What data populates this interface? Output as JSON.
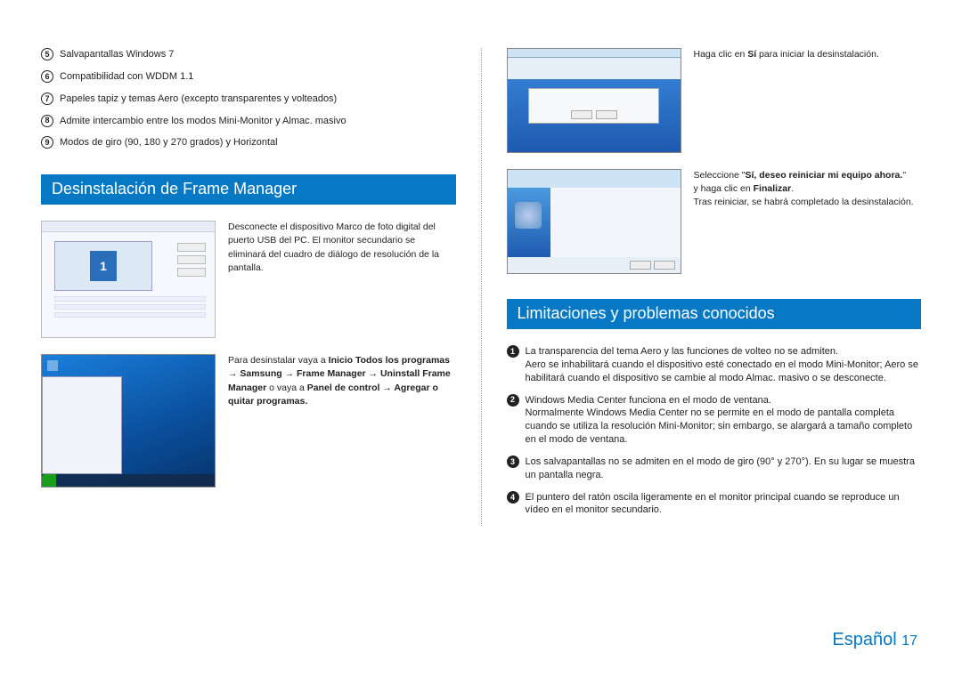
{
  "left": {
    "features": [
      {
        "n": "5",
        "text": "Salvapantallas Windows 7"
      },
      {
        "n": "6",
        "text": "Compatibilidad con WDDM 1.1"
      },
      {
        "n": "7",
        "text": "Papeles tapiz y temas Aero (excepto transparentes y volteados)"
      },
      {
        "n": "8",
        "text": "Admite intercambio entre los modos Mini-Monitor y Almac. masivo"
      },
      {
        "n": "9",
        "text": "Modos de giro (90, 180 y 270 grados) y Horizontal"
      }
    ],
    "uninstall_header": "Desinstalación de Frame Manager",
    "row1": "Desconecte el dispositivo Marco de foto digital del puerto USB del PC. El monitor secundario se eliminará del cuadro de diálogo de resolución de la pantalla.",
    "row2_pre": "Para desinstalar vaya a ",
    "row2_b1": "Inicio Todos los programas → Samsung → Frame Manager → Uninstall Frame Manager",
    "row2_mid": " o vaya a ",
    "row2_b2": "Panel de control → Agregar o quitar programas.",
    "mon_number": "1"
  },
  "right": {
    "row1_pre": "Haga clic en ",
    "row1_b": "Sí",
    "row1_post": " para iniciar la desinstalación.",
    "row2_l1_pre": "Seleccione \"",
    "row2_l1_b": "Sí, deseo reiniciar mi equipo ahora.",
    "row2_l1_post": "\"",
    "row2_l2_pre": "y haga clic en ",
    "row2_l2_b": "Finalizar",
    "row2_l2_post": ".",
    "row2_l3": "Tras reiniciar, se habrá completado la desinstalación.",
    "limits_header": "Limitaciones y problemas conocidos",
    "limits": [
      {
        "n": "1",
        "t1": "La transparencia del tema Aero y las funciones de volteo no se admiten.",
        "t2": "Aero se inhabilitará cuando el dispositivo esté conectado en el modo Mini-Monitor; Aero se habilitará cuando el dispositivo se cambie al modo Almac. masivo o se desconecte."
      },
      {
        "n": "2",
        "t1": "Windows Media Center funciona en el modo de ventana.",
        "t2": "Normalmente Windows Media Center no se permite en el modo de pantalla completa cuando se utiliza la resolución Mini-Monitor; sin embargo, se alargará a tamaño completo en el modo de ventana."
      },
      {
        "n": "3",
        "t1": "Los salvapantallas no se admiten en el modo de giro (90° y 270°). En su lugar se muestra un pantalla negra.",
        "t2": ""
      },
      {
        "n": "4",
        "t1": "El puntero del ratón oscila ligeramente en el monitor principal cuando se reproduce un vídeo en el monitor secundario.",
        "t2": ""
      }
    ]
  },
  "footer": {
    "lang": "Español",
    "page": "17"
  }
}
